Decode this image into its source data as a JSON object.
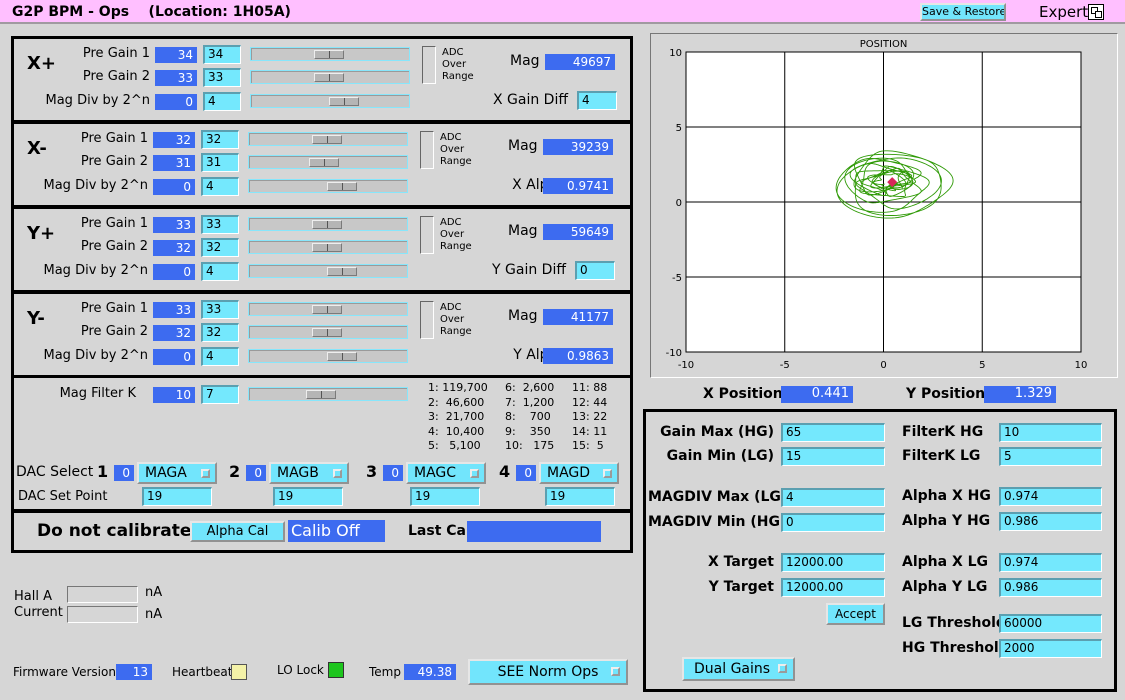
{
  "title": "G2P BPM - Ops    (Location: 1H05A)",
  "save_restore": "Save & Restore",
  "expert": "Expert",
  "expert_icon": "window-icon",
  "sections": [
    {
      "name": "X+",
      "pg1_label": "Pre Gain 1",
      "pg1_rd": "34",
      "pg1_ed": "34",
      "pg1_slider": 0.5,
      "pg2_label": "Pre Gain 2",
      "pg2_rd": "33",
      "pg2_ed": "33",
      "pg2_slider": 0.5,
      "md_label": "Mag Div by 2^n",
      "md_rd": "0",
      "md_ed": "4",
      "md_slider": 0.62,
      "adc": [
        "ADC",
        "Over",
        "Range"
      ],
      "mag_label": "Mag",
      "mag_val": "49697",
      "extra_label": "X Gain Diff",
      "extra_val": "4",
      "extra_editable": true
    },
    {
      "name": "X-",
      "pg1_label": "Pre Gain 1",
      "pg1_rd": "32",
      "pg1_ed": "32",
      "pg1_slider": 0.5,
      "pg2_label": "Pre Gain 2",
      "pg2_rd": "31",
      "pg2_ed": "31",
      "pg2_slider": 0.48,
      "md_label": "Mag Div by 2^n",
      "md_rd": "0",
      "md_ed": "4",
      "md_slider": 0.62,
      "adc": [
        "ADC",
        "Over",
        "Range"
      ],
      "mag_label": "Mag",
      "mag_val": "39239",
      "extra_label": "X Alpha",
      "extra_val": "0.9741",
      "extra_editable": false
    },
    {
      "name": "Y+",
      "pg1_label": "Pre Gain 1",
      "pg1_rd": "33",
      "pg1_ed": "33",
      "pg1_slider": 0.5,
      "pg2_label": "Pre Gain 2",
      "pg2_rd": "32",
      "pg2_ed": "32",
      "pg2_slider": 0.5,
      "md_label": "Mag Div by 2^n",
      "md_rd": "0",
      "md_ed": "4",
      "md_slider": 0.62,
      "adc": [
        "ADC",
        "Over",
        "Range"
      ],
      "mag_label": "Mag",
      "mag_val": "59649",
      "extra_label": "Y Gain Diff",
      "extra_val": "0",
      "extra_editable": true
    },
    {
      "name": "Y-",
      "pg1_label": "Pre Gain 1",
      "pg1_rd": "33",
      "pg1_ed": "33",
      "pg1_slider": 0.5,
      "pg2_label": "Pre Gain 2",
      "pg2_rd": "32",
      "pg2_ed": "32",
      "pg2_slider": 0.5,
      "md_label": "Mag Div by 2^n",
      "md_rd": "0",
      "md_ed": "4",
      "md_slider": 0.62,
      "adc": [
        "ADC",
        "Over",
        "Range"
      ],
      "mag_label": "Mag",
      "mag_val": "41177",
      "extra_label": "Y Alpha",
      "extra_val": "0.9863",
      "extra_editable": false
    }
  ],
  "filter": {
    "label": "Mag Filter K",
    "rd": "10",
    "ed": "7",
    "slider": 0.45,
    "table": [
      "1: 119,700",
      "2:  46,600",
      "3:  21,700",
      "4:  10,400",
      "5:   5,100",
      "6:  2,600",
      "7:  1,200",
      "8:    700",
      "9:    350",
      "10:   175",
      "11: 88",
      "12: 44",
      "13: 22",
      "14: 11",
      "15:  5"
    ]
  },
  "dac": {
    "select_label": "DAC Select",
    "setpoint_label": "DAC Set Point",
    "channels": [
      {
        "n": "1",
        "rd": "0",
        "menu": "MAGA",
        "set": "19"
      },
      {
        "n": "2",
        "rd": "0",
        "menu": "MAGB",
        "set": "19"
      },
      {
        "n": "3",
        "rd": "0",
        "menu": "MAGC",
        "set": "19"
      },
      {
        "n": "4",
        "rd": "0",
        "menu": "MAGD",
        "set": "19"
      }
    ]
  },
  "calib": {
    "status": "Do not calibrate",
    "alpha_btn": "Alpha Cal",
    "calib_state": "Calib Off",
    "last_label": "Last Cal",
    "last_val": ""
  },
  "hall": {
    "label": "Hall A\nCurrent",
    "unit1": "nA",
    "unit2": "nA",
    "v1": "",
    "v2": ""
  },
  "footer": {
    "fw_label": "Firmware Version",
    "fw_val": "13",
    "hb_label": "Heartbeat",
    "lo_label": "LO Lock",
    "temp_label": "Temp",
    "temp_val": "49.38",
    "norm_btn": "SEE Norm Ops"
  },
  "plot": {
    "title": "POSITION",
    "x_ticks": [
      "-10",
      "-5",
      "0",
      "5",
      "10"
    ],
    "y_ticks": [
      "10",
      "5",
      "0",
      "-5",
      "-10"
    ]
  },
  "chart_data": {
    "type": "scatter",
    "title": "POSITION",
    "xlim": [
      -10,
      10
    ],
    "ylim": [
      -10,
      10
    ],
    "grid": true,
    "marker": {
      "x": 0.441,
      "y": 1.329
    },
    "trace_color": "#2f9a06",
    "marker_color": "#d7265a",
    "trace_center": [
      0.3,
      1.3
    ],
    "trace_radius": [
      3.2,
      2.5
    ]
  },
  "positions": {
    "x_label": "X Position",
    "x_val": "0.441",
    "y_label": "Y Position",
    "y_val": "1.329"
  },
  "settings": {
    "left": [
      {
        "label": "Gain Max (HG)",
        "val": "65"
      },
      {
        "label": "Gain Min (LG)",
        "val": "15"
      },
      {
        "label": "MAGDIV Max (LG)",
        "val": "4"
      },
      {
        "label": "MAGDIV Min (HG)",
        "val": "0"
      },
      {
        "label": "X Target",
        "val": "12000.00"
      },
      {
        "label": "Y Target",
        "val": "12000.00"
      }
    ],
    "right": [
      {
        "label": "FilterK HG",
        "val": "10"
      },
      {
        "label": "FilterK LG",
        "val": "5"
      },
      {
        "label": "Alpha X HG",
        "val": "0.974"
      },
      {
        "label": "Alpha Y HG",
        "val": "0.986"
      },
      {
        "label": "Alpha X LG",
        "val": "0.974"
      },
      {
        "label": "Alpha Y LG",
        "val": "0.986"
      },
      {
        "label": "LG Threshold",
        "val": "60000"
      },
      {
        "label": "HG Threshold",
        "val": "2000"
      }
    ],
    "accept": "Accept",
    "dual": "Dual Gains"
  },
  "colors": {
    "readback": "#3d6bf0",
    "edit": "#74e8fd",
    "title_bg": "#ffbfff",
    "bg": "#d6d6d6",
    "lo_lock": "#1ec51e",
    "heartbeat": "#f4f2a8"
  }
}
